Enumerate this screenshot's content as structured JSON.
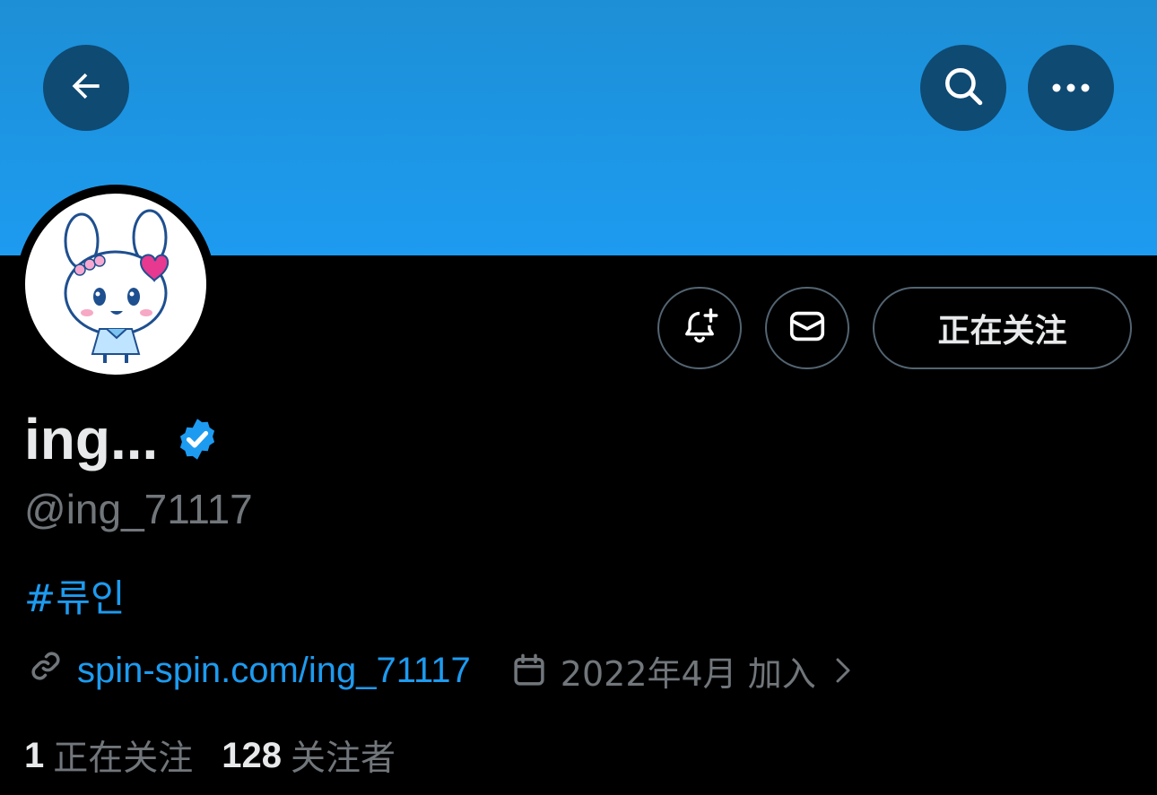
{
  "header": {
    "back_icon": "arrow-left-icon",
    "search_icon": "search-icon",
    "more_icon": "more-horizontal-icon",
    "banner_color": "#1d9bf0",
    "button_bg": "#0f4a73"
  },
  "profile": {
    "display_name": "ing...",
    "verified_icon": "verified-badge-icon",
    "verified_color": "#1d9bf0",
    "handle": "@ing_71117",
    "bio_hashtag": "#류인",
    "link_icon": "link-icon",
    "link": "spin-spin.com/ing_71117",
    "calendar_icon": "calendar-icon",
    "joined": "2022年4月 加入",
    "chevron_icon": "chevron-right-icon"
  },
  "actions": {
    "notify_icon": "bell-plus-icon",
    "dm_icon": "envelope-icon",
    "follow_label": "正在关注"
  },
  "stats": {
    "following_count": "1",
    "following_label": "正在关注",
    "followers_count": "128",
    "followers_label": "关注者"
  },
  "colors": {
    "background": "#000000",
    "text_primary": "#e7e9ea",
    "text_secondary": "#71767b",
    "accent": "#1d9bf0",
    "border": "#536471"
  }
}
